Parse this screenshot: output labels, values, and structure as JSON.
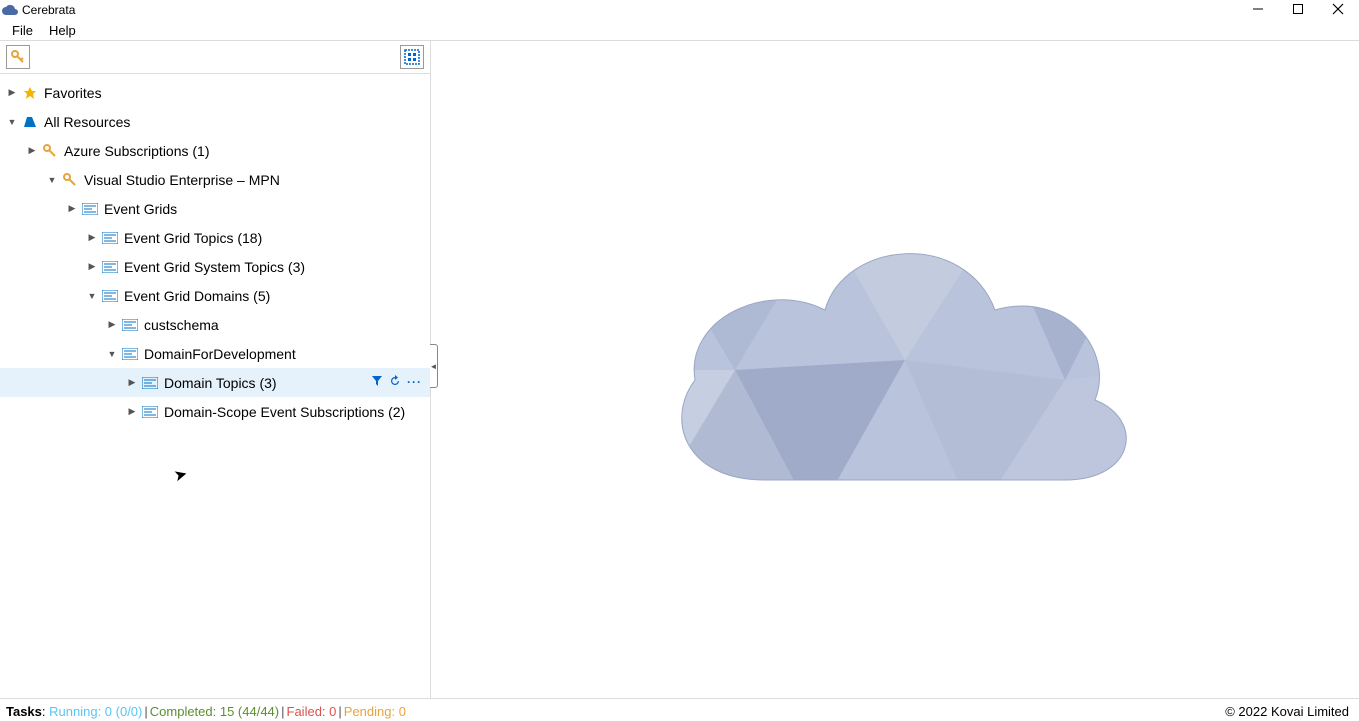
{
  "window": {
    "title": "Cerebrata",
    "menu": {
      "file": "File",
      "help": "Help"
    }
  },
  "tree": {
    "favorites": "Favorites",
    "all_resources": "All Resources",
    "azure_subs": "Azure Subscriptions (1)",
    "vs_enterprise": "Visual Studio Enterprise – MPN",
    "event_grids": "Event Grids",
    "eg_topics": "Event Grid Topics (18)",
    "eg_system_topics": "Event Grid System Topics (3)",
    "eg_domains": "Event Grid Domains (5)",
    "custschema": "custschema",
    "domain_dev": "DomainForDevelopment",
    "domain_topics": "Domain Topics (3)",
    "domain_scope_subs": "Domain-Scope Event Subscriptions (2)"
  },
  "status": {
    "tasks_label": "Tasks",
    "running": "Running: 0 (0/0)",
    "completed": "Completed: 15 (44/44)",
    "failed": "Failed: 0",
    "pending": "Pending: 0",
    "copyright": "© 2022 Kovai Limited"
  }
}
